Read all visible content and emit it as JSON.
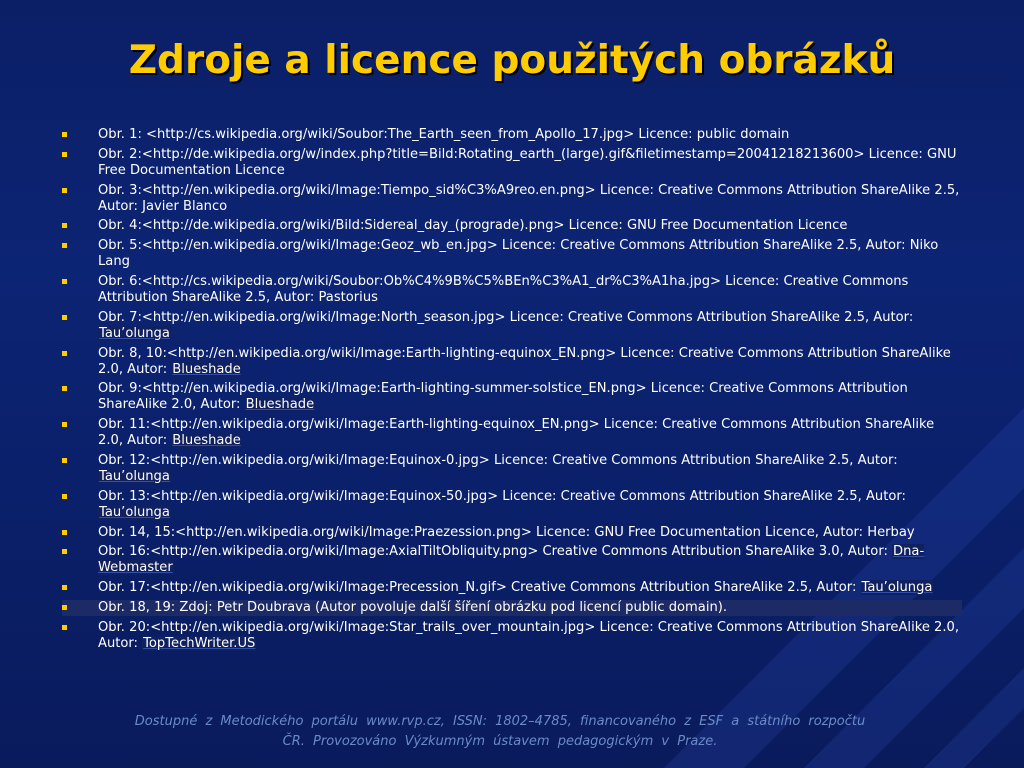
{
  "slide": {
    "title": "Zdroje a licence použitých obrázků",
    "items": [
      {
        "text": "Obr. 1: <http://cs.wikipedia.org/wiki/Soubor:The_Earth_seen_from_Apollo_17.jpg> Licence: public domain",
        "author": ""
      },
      {
        "text": "Obr. 2:<http://de.wikipedia.org/w/index.php?title=Bild:Rotating_earth_(large).gif&filetimestamp=20041218213600> Licence: GNU Free Documentation Licence",
        "author": ""
      },
      {
        "text": "Obr. 3:<http://en.wikipedia.org/wiki/Image:Tiempo_sid%C3%A9reo.en.png> Licence: Creative Commons Attribution ShareAlike 2.5, Autor: Javier Blanco",
        "author": ""
      },
      {
        "text": "Obr. 4:<http://de.wikipedia.org/wiki/Bild:Sidereal_day_(prograde).png> Licence: GNU Free Documentation Licence",
        "author": ""
      },
      {
        "text": "Obr. 5:<http://en.wikipedia.org/wiki/Image:Geoz_wb_en.jpg> Licence: Creative Commons Attribution ShareAlike 2.5, Autor: Niko Lang",
        "author": ""
      },
      {
        "text": "Obr. 6:<http://cs.wikipedia.org/wiki/Soubor:Ob%C4%9B%C5%BEn%C3%A1_dr%C3%A1ha.jpg> Licence: Creative Commons Attribution ShareAlike 2.5, Autor: Pastorius",
        "author": ""
      },
      {
        "text": "Obr. 7:<http://en.wikipedia.org/wiki/Image:North_season.jpg> Licence: Creative Commons Attribution ShareAlike 2.5, Autor: ",
        "author": "Tau’olunga"
      },
      {
        "text": "Obr. 8, 10:<http://en.wikipedia.org/wiki/Image:Earth-lighting-equinox_EN.png> Licence: Creative Commons Attribution ShareAlike 2.0, Autor: ",
        "author": "Blueshade"
      },
      {
        "text": "Obr. 9:<http://en.wikipedia.org/wiki/Image:Earth-lighting-summer-solstice_EN.png> Licence: Creative Commons Attribution ShareAlike 2.0, Autor: ",
        "author": "Blueshade"
      },
      {
        "text": "Obr. 11:<http://en.wikipedia.org/wiki/Image:Earth-lighting-equinox_EN.png> Licence: Creative Commons Attribution ShareAlike 2.0, Autor: ",
        "author": "Blueshade"
      },
      {
        "text": "Obr. 12:<http://en.wikipedia.org/wiki/Image:Equinox-0.jpg> Licence: Creative Commons Attribution ShareAlike 2.5, Autor: ",
        "author": "Tau’olunga"
      },
      {
        "text": "Obr. 13:<http://en.wikipedia.org/wiki/Image:Equinox-50.jpg> Licence: Creative Commons Attribution ShareAlike 2.5, Autor: ",
        "author": "Tau’olunga"
      },
      {
        "text": "Obr. 14, 15:<http://en.wikipedia.org/wiki/Image:Praezession.png> Licence: GNU Free Documentation Licence, Autor: Herbay",
        "author": ""
      },
      {
        "text": "Obr. 16:<http://en.wikipedia.org/wiki/Image:AxialTiltObliquity.png> Creative Commons Attribution ShareAlike 3.0, Autor: ",
        "author": "Dna-Webmaster"
      },
      {
        "text": "Obr. 17:<http://en.wikipedia.org/wiki/Image:Precession_N.gif> Creative Commons Attribution ShareAlike 2.5, Autor: ",
        "author": "Tau’olunga"
      },
      {
        "text": "Obr. 18, 19: Zdoj: Petr Doubrava (Autor povoluje další šíření obrázku pod licencí public domain).",
        "author": "",
        "highlight": true
      },
      {
        "text": "Obr. 20:<http://en.wikipedia.org/wiki/Image:Star_trails_over_mountain.jpg> Licence: Creative Commons Attribution ShareAlike 2.0, Autor: ",
        "author": "TopTechWriter.US"
      }
    ],
    "footer_line1": "Dostupné z Metodického portálu www.rvp.cz, ISSN: 1802–4785, financovaného z ESF a státního rozpočtu",
    "footer_line2": "ČR. Provozováno Výzkumným ústavem pedagogickým v Praze."
  },
  "colors": {
    "background": "#0c2474",
    "title": "#ffcc00",
    "bullet": "#ffcc00",
    "text": "#ffffff",
    "footer": "#6a8ac8"
  }
}
